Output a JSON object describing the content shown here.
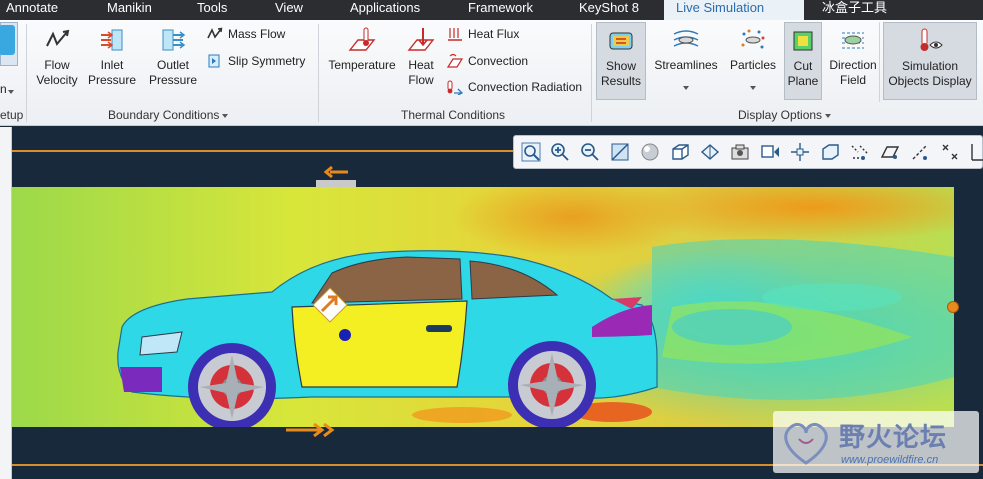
{
  "menu": {
    "tabs": [
      {
        "label": "Annotate"
      },
      {
        "label": "Manikin"
      },
      {
        "label": "Tools"
      },
      {
        "label": "View"
      },
      {
        "label": "Applications"
      },
      {
        "label": "Framework"
      },
      {
        "label": "KeyShot 8"
      },
      {
        "label": "Live Simulation"
      },
      {
        "label": "冰盒子工具"
      }
    ]
  },
  "ribbon": {
    "setup": {
      "partial_label": "n",
      "group_label": "etup"
    },
    "boundary": {
      "flow_velocity": "Flow\nVelocity",
      "inlet_pressure": "Inlet\nPressure",
      "outlet_pressure": "Outlet\nPressure",
      "mass_flow": "Mass Flow",
      "slip_symmetry": "Slip Symmetry",
      "group_label": "Boundary Conditions"
    },
    "thermal": {
      "temperature": "Temperature",
      "heat_flow": "Heat\nFlow",
      "heat_flux": "Heat Flux",
      "convection": "Convection",
      "convection_radiation": "Convection Radiation",
      "group_label": "Thermal Conditions"
    },
    "display": {
      "show_results": "Show\nResults",
      "streamlines": "Streamlines",
      "particles": "Particles",
      "cut_plane": "Cut\nPlane",
      "direction_field": "Direction\nField",
      "group_label": "Display Options"
    },
    "sim_objects": {
      "label": "Simulation\nObjects Display"
    }
  },
  "viewport": {
    "toolbar_icons": [
      "refit-icon",
      "zoom-in-icon",
      "zoom-out-icon",
      "repaint-icon",
      "shading-icon",
      "standard-orientation-icon",
      "saved-orientations-icon",
      "view-manager-icon",
      "perspective-icon",
      "spin-center-icon",
      "annotation-display-icon",
      "datum-display-icon",
      "plane-display-icon",
      "axis-display-icon",
      "point-display-icon",
      "csys-display-icon"
    ]
  },
  "watermark": {
    "title": "野火论坛",
    "url": "www.proewildfire.cn"
  },
  "colors": {
    "accent": "#2a6cb0",
    "orange_line": "#d98d2a",
    "car_cyan": "#2fd8e6",
    "door_yellow": "#f3ef22",
    "wheel_blue": "#3c2fb4"
  }
}
